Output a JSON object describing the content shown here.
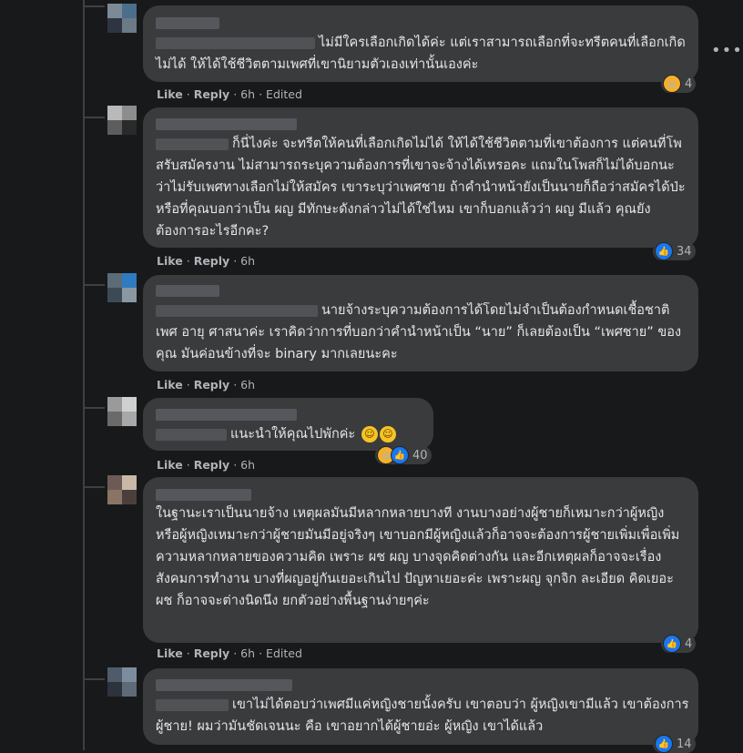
{
  "meta_labels": {
    "like": "Like",
    "reply": "Reply"
  },
  "comments": [
    {
      "text": "ไม่มีใครเลือกเกิดได้ค่ะ แต่เราสามารถเลือกที่จะทรีตคนที่เลือกเกิดไม่ได้ ให้ได้ใช้ชีวิตตามเพศที่เขานิยามตัวเองเท่านั้นเองค่ะ",
      "time": "6h",
      "edited": "Edited",
      "reaction": {
        "icon": "haha",
        "count": "4"
      }
    },
    {
      "text": "ก็นี่ไงค่ะ จะทรีตให้คนที่เลือกเกิดไม่ได้ ให้ได้ใช้ชีวิตตามที่เขาต้องการ แต่คนที่โพสรับสมัครงาน ไม่สามารถระบุความต้องการที่เขาจะจ้างได้เหรอคะ แถมในโพสก็ไม่ได้บอกนะ ว่าไม่รับเพศทางเลือกไม่ให้สมัคร เขาระบุว่าเพศชาย ถ้าคำนำหน้ายังเป็นนายก็ถือว่าสมัครได้ป่ะ หรือที่คุณบอกว่าเป็น ผญ มีทักษะดังกล่าวไม่ได้ใช่ไหม เขาก็บอกแล้วว่า ผญ มีแล้ว คุณยังต้องการอะไรอีกคะ?",
      "time": "6h",
      "edited": "",
      "reaction": {
        "icon": "like",
        "count": "34"
      }
    },
    {
      "text": "นายจ้างระบุความต้องการได้โดยไม่จำเป็นต้องกำหนดเชื้อชาติ เพศ อายุ ศาสนาค่ะ เราคิดว่าการที่บอกว่าคำนำหน้าเป็น “นาย” ก็เลยต้องเป็น “เพศชาย” ของคุณ มันค่อนข้างที่จะ binary มากเลยนะคะ",
      "time": "6h",
      "edited": "",
      "reaction": null
    },
    {
      "text": "แนะนำให้คุณไปพักค่ะ",
      "time": "6h",
      "edited": "",
      "reaction": {
        "icon": "haha-like",
        "count": "40"
      }
    },
    {
      "text": "ในฐานะเราเป็นนายจ้าง เหตุผลมันมีหลากหลายบางที งานบางอย่างผู้ชายก็เหมาะกว่าผู้หญิง หรือผู้หญิงเหมาะกว่าผู้ชายมันมีอยู่จริงๆ เขาบอกมีผู้หญิงแล้วก็อาจจะต้องการผู้ชายเพิ่มเพื่อเพิ่มความหลากหลายของความคิด เพราะ ผช ผญ บางจุดคิดต่างกัน และอีกเหตุผลก็อาจจะเรื่องสังคมการทำงาน บางที่ผญอยู่กันเยอะเกินไป ปัญหาเยอะค่ะ เพราะผญ จุกจิก ละเอียด คิดเยอะ ผช ก็อาจจะต่างนิดนึง ยกตัวอย่างพื้นฐานง่ายๆค่ะ",
      "time": "6h",
      "edited": "Edited",
      "reaction": {
        "icon": "like",
        "count": "4"
      }
    },
    {
      "text": "เขาไม่ได้ตอบว่าเพศมีแค่หญิงชายนั้งครับ เขาตอบว่า ผู้หญิงเขามีแล้ว เขาต้องการผู้ชาย! ผมว่ามันชัดเจนนะ คือ เขาอยากได้ผู้ชายอ่ะ ผู้หญิง เขาได้แล้ว",
      "time": "",
      "edited": "",
      "reaction": {
        "icon": "like",
        "count": "14"
      }
    }
  ]
}
